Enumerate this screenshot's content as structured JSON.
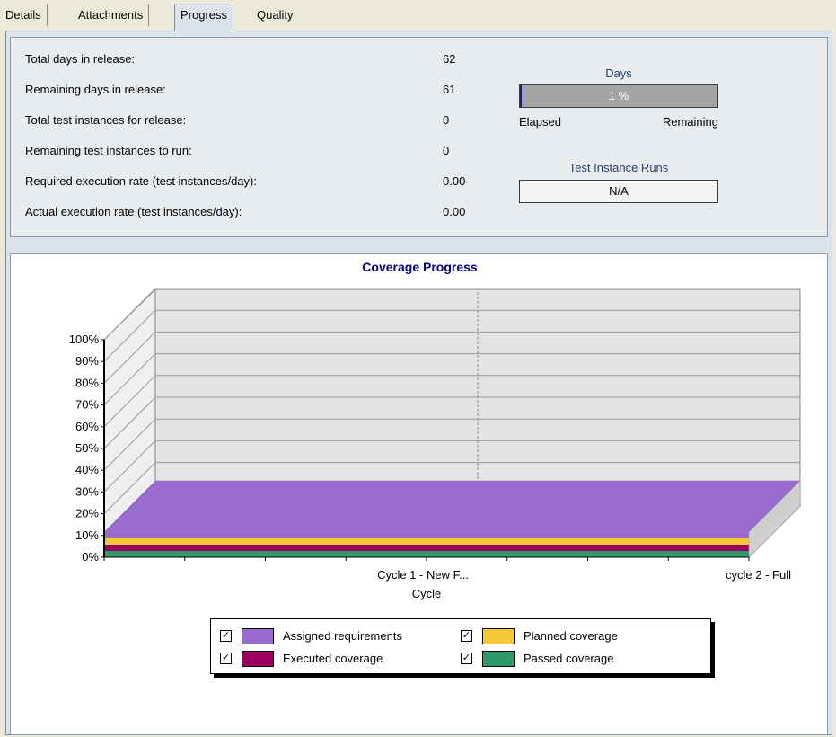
{
  "tabs": [
    {
      "label": "Details",
      "active": false
    },
    {
      "label": "Attachments",
      "active": false
    },
    {
      "label": "Progress",
      "active": true
    },
    {
      "label": "Quality",
      "active": false
    }
  ],
  "stats": [
    {
      "label": "Total days in release:",
      "value": "62"
    },
    {
      "label": "Remaining days in release:",
      "value": "61"
    },
    {
      "label": "Total test instances for release:",
      "value": "0"
    },
    {
      "label": "Remaining test instances to run:",
      "value": "0"
    },
    {
      "label": "Required execution rate (test instances/day):",
      "value": "0.00"
    },
    {
      "label": "Actual execution rate (test instances/day):",
      "value": "0.00"
    }
  ],
  "days_bar": {
    "title": "Days",
    "percent_text": "1 %",
    "elapsed_fraction": 0.01,
    "left_label": "Elapsed",
    "right_label": "Remaining"
  },
  "runs_bar": {
    "title": "Test Instance Runs",
    "value_text": "N/A"
  },
  "chart_data": {
    "type": "bar",
    "title": "Coverage Progress",
    "xlabel": "Cycle",
    "ylabel": "",
    "categories": [
      "Cycle 1 - New F...",
      "cycle 2 - Full"
    ],
    "y_ticks": [
      "0%",
      "10%",
      "20%",
      "30%",
      "40%",
      "50%",
      "60%",
      "70%",
      "80%",
      "90%",
      "100%"
    ],
    "ylim": [
      0,
      100
    ],
    "stacked": true,
    "series": [
      {
        "name": "Passed coverage",
        "values": [
          0,
          0
        ],
        "color": "#2e9a6a"
      },
      {
        "name": "Executed coverage",
        "values": [
          0,
          0
        ],
        "color": "#9b0060"
      },
      {
        "name": "Planned coverage",
        "values": [
          0,
          0
        ],
        "color": "#f6c838"
      },
      {
        "name": "Assigned requirements",
        "values": [
          0,
          0
        ],
        "color": "#9a6bcf"
      }
    ],
    "legend": [
      {
        "name": "Assigned requirements",
        "color": "#9a6bcf",
        "checked": true
      },
      {
        "name": "Planned coverage",
        "color": "#f6c838",
        "checked": true
      },
      {
        "name": "Executed coverage",
        "color": "#9b0060",
        "checked": true
      },
      {
        "name": "Passed coverage",
        "color": "#2e9a6a",
        "checked": true
      }
    ],
    "grid": true,
    "legend_position": "bottom"
  }
}
